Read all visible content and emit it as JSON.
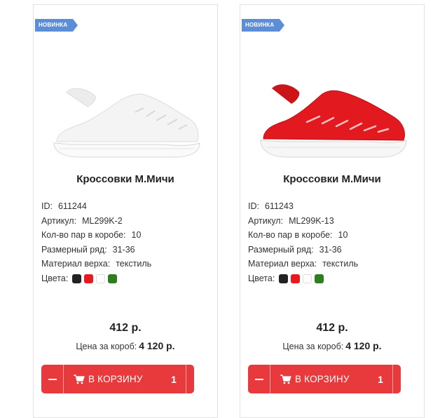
{
  "products": [
    {
      "badge": "НОВИНКА",
      "title": "Кроссовки М.Мичи",
      "image_color": "white",
      "props": {
        "id_label": "ID:",
        "id_value": "611244",
        "article_label": "Артикул:",
        "article_value": "ML299K-2",
        "pairs_label": "Кол-во пар в коробе:",
        "pairs_value": "10",
        "sizes_label": "Размерный ряд:",
        "sizes_value": "31-36",
        "material_label": "Материал верха:",
        "material_value": "текстиль",
        "colors_label": "Цвета:"
      },
      "colors": [
        "#222222",
        "#e8191f",
        "#ffffff",
        "#2e7d1e"
      ],
      "price": "412 р.",
      "box_price_label": "Цена за короб:",
      "box_price_value": "4 120 р.",
      "cart": {
        "minus": "−",
        "add_label": "В КОРЗИНУ",
        "qty": "1"
      }
    },
    {
      "badge": "НОВИНКА",
      "title": "Кроссовки М.Мичи",
      "image_color": "red",
      "props": {
        "id_label": "ID:",
        "id_value": "611243",
        "article_label": "Артикул:",
        "article_value": "ML299K-13",
        "pairs_label": "Кол-во пар в коробе:",
        "pairs_value": "10",
        "sizes_label": "Размерный ряд:",
        "sizes_value": "31-36",
        "material_label": "Материал верха:",
        "material_value": "текстиль",
        "colors_label": "Цвета:"
      },
      "colors": [
        "#222222",
        "#e8191f",
        "#ffffff",
        "#2e7d1e"
      ],
      "price": "412 р.",
      "box_price_label": "Цена за короб:",
      "box_price_value": "4 120 р.",
      "cart": {
        "minus": "−",
        "add_label": "В КОРЗИНУ",
        "qty": "1"
      }
    }
  ],
  "accent_color": "#e8393c",
  "badge_color": "#5b8ed6"
}
